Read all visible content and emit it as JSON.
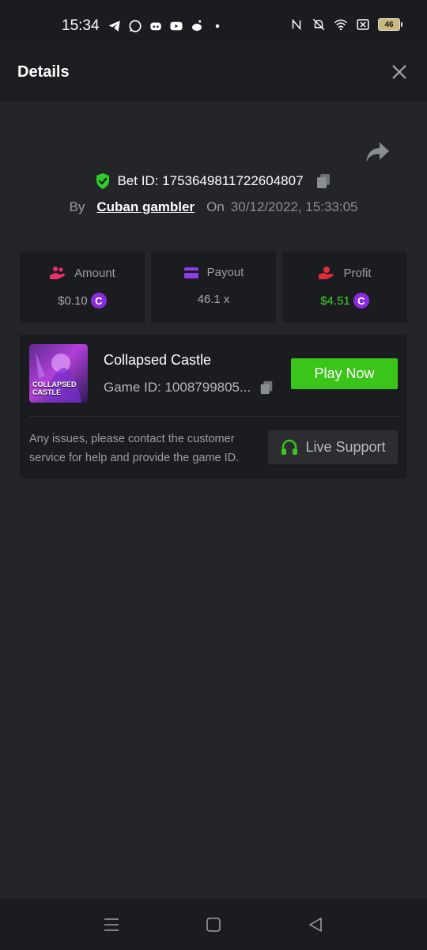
{
  "status_bar": {
    "time": "15:34",
    "battery": "46",
    "left_icons": [
      "telegram-icon",
      "whatsapp-icon",
      "discord-icon",
      "youtube-icon",
      "reddit-icon",
      "dot-icon"
    ],
    "right_icons": [
      "nfc-icon",
      "bell-off-icon",
      "wifi-icon",
      "close-box-icon",
      "battery-icon"
    ]
  },
  "header": {
    "title": "Details",
    "close_icon": "close-icon"
  },
  "bet": {
    "id_label": "Bet ID: 1753649811722604807",
    "by_label": "By",
    "username": "Cuban gambler",
    "on_label": "On",
    "datetime": "30/12/2022, 15:33:05"
  },
  "stats": {
    "amount": {
      "label": "Amount",
      "value": "$0.10",
      "icon": "hand-coins-icon"
    },
    "payout": {
      "label": "Payout",
      "value": "46.1 x",
      "icon": "card-icon"
    },
    "profit": {
      "label": "Profit",
      "value": "$4.51",
      "icon": "hand-profit-icon"
    },
    "coin_glyph": "C"
  },
  "game": {
    "thumb_text_line1": "COLLAPSED",
    "thumb_text_line2": "CASTLE",
    "name": "Collapsed Castle",
    "id": "Game ID: 1008799805...",
    "play_label": "Play Now",
    "support_text": "Any issues, please contact the customer service for help and provide the game ID.",
    "support_label": "Live Support"
  },
  "colors": {
    "background": "#232528",
    "panel": "#1b1c1f",
    "accent_green": "#3bc51b",
    "profit_green": "#3fd62e",
    "coin_purple": "#8a2be2"
  }
}
